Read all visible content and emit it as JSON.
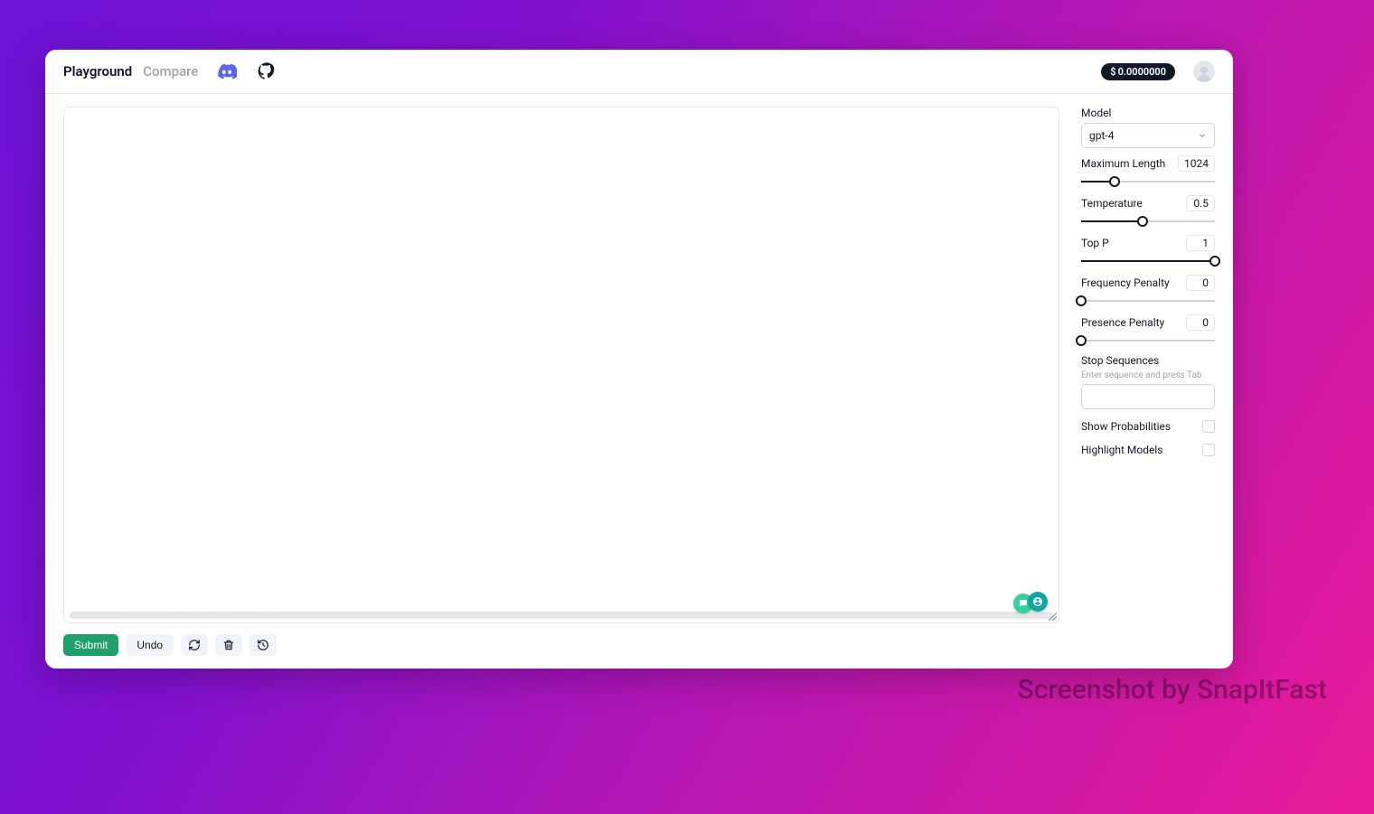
{
  "nav": {
    "playground": "Playground",
    "compare": "Compare"
  },
  "cost": {
    "currency": "$",
    "amount": "0.0000000"
  },
  "actions": {
    "submit": "Submit",
    "undo": "Undo"
  },
  "panel": {
    "model_label": "Model",
    "model_value": "gpt-4",
    "max_len_label": "Maximum Length",
    "max_len_value": "1024",
    "max_len_pct": 25,
    "temp_label": "Temperature",
    "temp_value": "0.5",
    "temp_pct": 46,
    "top_p_label": "Top P",
    "top_p_value": "1",
    "top_p_pct": 100,
    "freq_label": "Frequency Penalty",
    "freq_value": "0",
    "freq_pct": 0,
    "pres_label": "Presence Penalty",
    "pres_value": "0",
    "pres_pct": 0,
    "stop_label": "Stop Sequences",
    "stop_hint": "Enter sequence and press Tab",
    "show_prob_label": "Show Probabilities",
    "highlight_label": "Highlight Models"
  },
  "watermark": "Screenshot by SnapItFast"
}
